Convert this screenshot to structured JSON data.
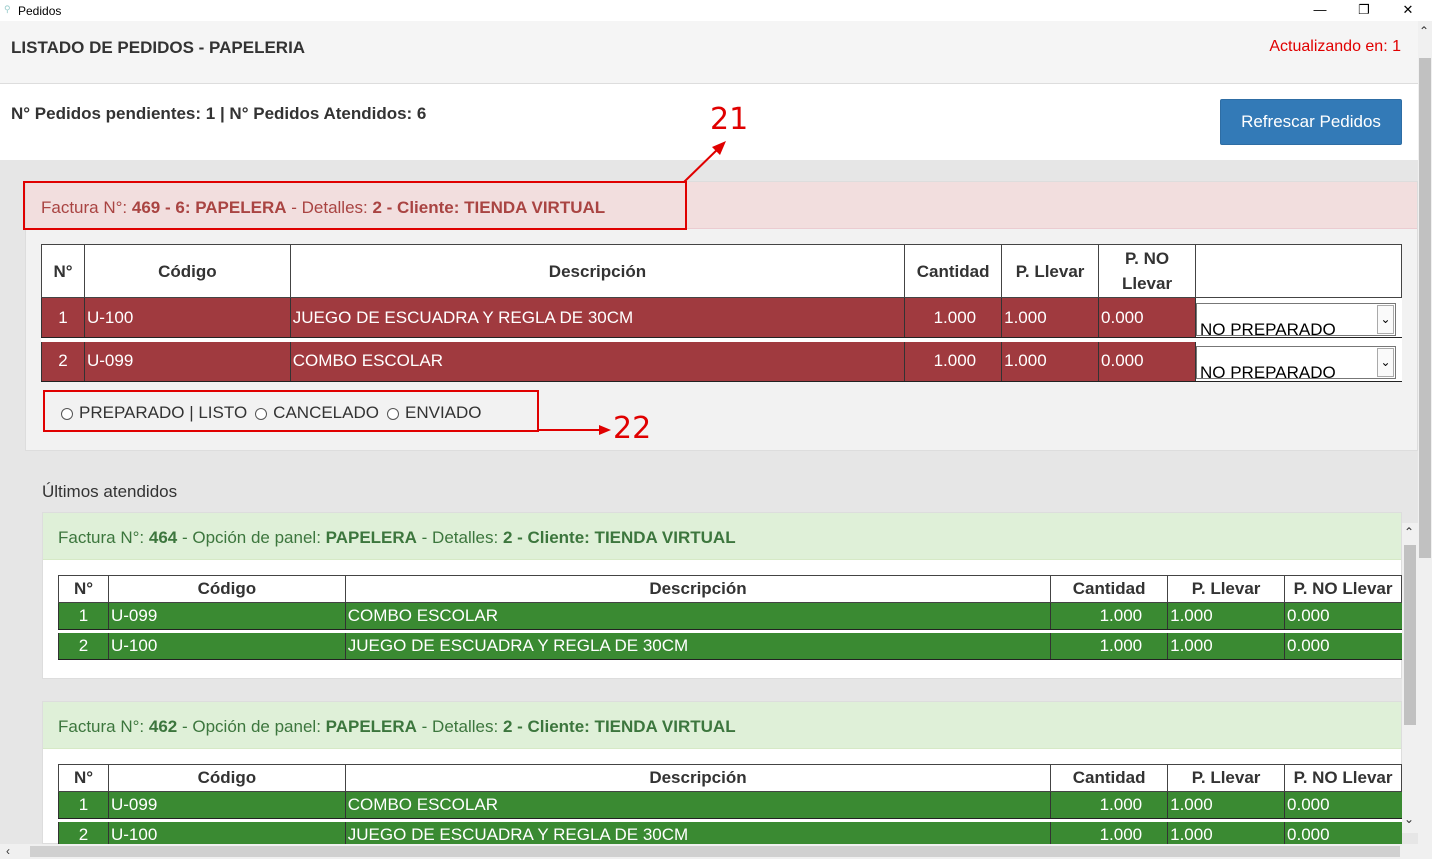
{
  "window": {
    "title": "Pedidos"
  },
  "header": {
    "title": "LISTADO DE PEDIDOS - PAPELERIA",
    "updating": "Actualizando en: 1"
  },
  "summary": {
    "text": "N° Pedidos pendientes: 1 | N° Pedidos Atendidos: 6",
    "refresh_label": "Refrescar Pedidos"
  },
  "pending": {
    "head_prefix": "Factura N°: ",
    "head_bold": "469 - 6: PAPELERA",
    "head_mid": " - Detalles: ",
    "head_bold2": "2 - Cliente: TIENDA VIRTUAL",
    "columns": [
      "N°",
      "Código",
      "Descripción",
      "Cantidad",
      "P. Llevar",
      "P. NO Llevar",
      ""
    ],
    "rows": [
      {
        "n": "1",
        "codigo": "U-100",
        "descripcion": "JUEGO DE ESCUADRA Y REGLA DE 30CM",
        "cantidad": "1.000",
        "llevar": "1.000",
        "no_llevar": "0.000",
        "estado": "NO PREPARADO"
      },
      {
        "n": "2",
        "codigo": "U-099",
        "descripcion": "COMBO ESCOLAR",
        "cantidad": "1.000",
        "llevar": "1.000",
        "no_llevar": "0.000",
        "estado": "NO PREPARADO"
      }
    ],
    "radios": [
      "PREPARADO | LISTO",
      "CANCELADO",
      "ENVIADO"
    ]
  },
  "attended_title": "Últimos atendidos",
  "attended": [
    {
      "head_prefix": "Factura N°: ",
      "factura": "464",
      "head_mid": " - Opción de panel: ",
      "panel": "PAPELERA",
      "head_mid2": " - Detalles: ",
      "detalles": "2 - Cliente: TIENDA VIRTUAL",
      "columns": [
        "N°",
        "Código",
        "Descripción",
        "Cantidad",
        "P. Llevar",
        "P. NO Llevar"
      ],
      "rows": [
        {
          "n": "1",
          "codigo": "U-099",
          "descripcion": "COMBO ESCOLAR",
          "cantidad": "1.000",
          "llevar": "1.000",
          "no_llevar": "0.000"
        },
        {
          "n": "2",
          "codigo": "U-100",
          "descripcion": "JUEGO DE ESCUADRA Y REGLA DE 30CM",
          "cantidad": "1.000",
          "llevar": "1.000",
          "no_llevar": "0.000"
        }
      ]
    },
    {
      "head_prefix": "Factura N°: ",
      "factura": "462",
      "head_mid": " - Opción de panel: ",
      "panel": "PAPELERA",
      "head_mid2": " - Detalles: ",
      "detalles": "2 - Cliente: TIENDA VIRTUAL",
      "columns": [
        "N°",
        "Código",
        "Descripción",
        "Cantidad",
        "P. Llevar",
        "P. NO Llevar"
      ],
      "rows": [
        {
          "n": "1",
          "codigo": "U-099",
          "descripcion": "COMBO ESCOLAR",
          "cantidad": "1.000",
          "llevar": "1.000",
          "no_llevar": "0.000"
        },
        {
          "n": "2",
          "codigo": "U-100",
          "descripcion": "JUEGO DE ESCUADRA Y REGLA DE 30CM",
          "cantidad": "1.000",
          "llevar": "1.000",
          "no_llevar": "0.000"
        }
      ]
    }
  ],
  "annotations": [
    "21",
    "22"
  ],
  "colors": {
    "pending_row": "#a03a3f",
    "attended_row": "#3a8a32",
    "refresh_button": "#337ab7",
    "annotation": "#e00000"
  }
}
